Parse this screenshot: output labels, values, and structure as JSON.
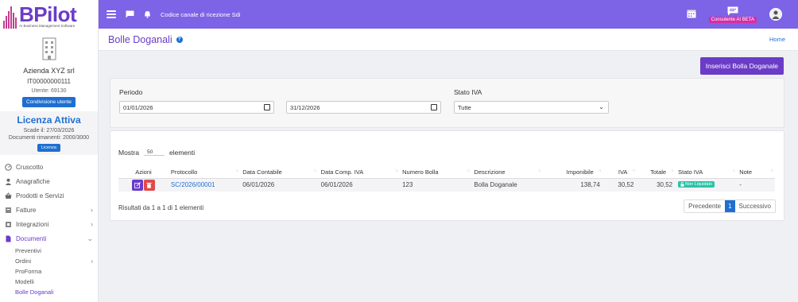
{
  "brand": {
    "logo_name": "BPilot",
    "logo_sub": "AI Business Management Software",
    "color": "#6a3cc8"
  },
  "company": {
    "name": "Azienda XYZ srl",
    "vat": "IT00000000111",
    "user": "Utente: 69130",
    "share_button": "Condivisione utente"
  },
  "license": {
    "title": "Licenza Attiva",
    "expires": "Scade il: 27/03/2026",
    "docs": "Documenti rimanenti: 2000/3000",
    "button": "Licenza"
  },
  "menu": [
    {
      "label": "Cruscotto",
      "icon": "dashboard-icon",
      "chevron": ""
    },
    {
      "label": "Anagrafiche",
      "icon": "user-icon",
      "chevron": ""
    },
    {
      "label": "Prodotti e Servizi",
      "icon": "basket-icon",
      "chevron": ""
    },
    {
      "label": "Fatture",
      "icon": "invoice-icon",
      "chevron": "›"
    },
    {
      "label": "Integrazioni",
      "icon": "integration-icon",
      "chevron": "›"
    },
    {
      "label": "Documenti",
      "icon": "document-icon",
      "chevron": "⌄"
    }
  ],
  "submenu": [
    {
      "label": "Preventivi",
      "chevron": ""
    },
    {
      "label": "Ordini",
      "chevron": "›"
    },
    {
      "label": "ProForma",
      "chevron": ""
    },
    {
      "label": "Modelli",
      "chevron": ""
    },
    {
      "label": "Bolle Doganali",
      "chevron": ""
    }
  ],
  "topbar": {
    "title": "Codice canale di ricezione Sdi",
    "consultant_badge": "Consulente AI BETA",
    "color": "#7d63e6"
  },
  "page": {
    "title": "Bolle Doganali",
    "breadcrumb": "Home",
    "insert_button": "Inserisci Bolla Doganale"
  },
  "filters": {
    "period_label": "Periodo",
    "date_from": "01/01/2026",
    "date_to": "31/12/2026",
    "vat_label": "Stato IVA",
    "vat_value": "Tutte"
  },
  "table": {
    "show_label": "Mostra",
    "show_value": "50",
    "show_suffix": "elementi",
    "headers": [
      "Azioni",
      "Protocollo",
      "Data Contabile",
      "Data Comp. IVA",
      "Numero Bolla",
      "Descrizione",
      "Imponibile",
      "IVA",
      "Totale",
      "Stato IVA",
      "Note"
    ],
    "rows": [
      {
        "protocollo": "SC/2026/00001",
        "data_contabile": "06/01/2026",
        "data_comp_iva": "06/01/2026",
        "numero_bolla": "123",
        "descrizione": "Bolla Doganale",
        "imponibile": "138,74",
        "iva": "30,52",
        "totale": "30,52",
        "stato_iva": "Non Liquidato",
        "note": "-"
      }
    ],
    "info": "Risultati da 1 a 1 di 1 elementi",
    "pager": {
      "prev": "Precedente",
      "current": "1",
      "next": "Successivo"
    }
  }
}
